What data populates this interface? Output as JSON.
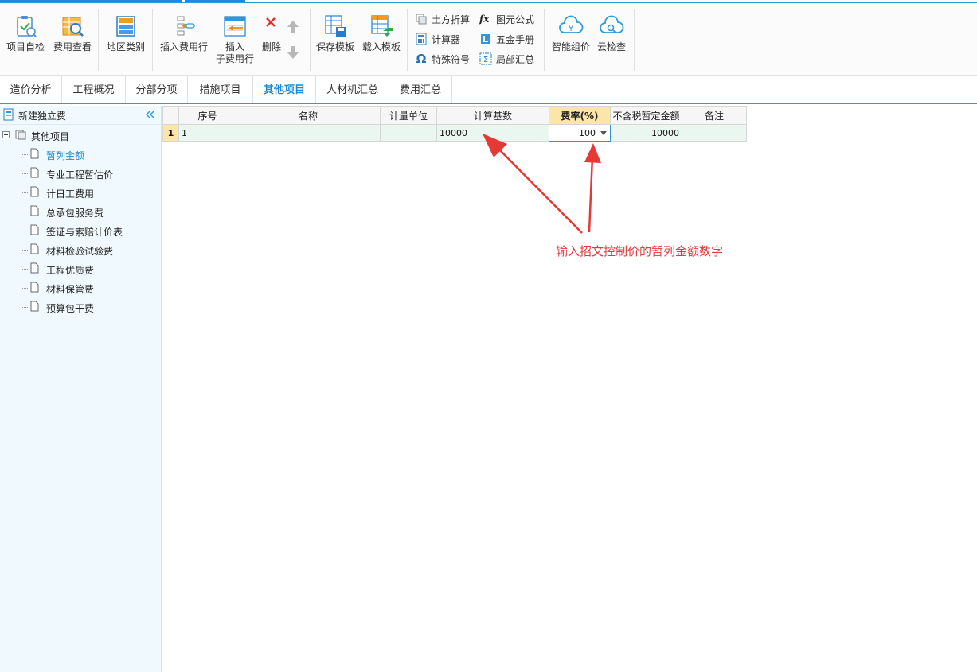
{
  "toolbar": {
    "buttons": {
      "self_check": "项目自检",
      "fee_view": "费用查看",
      "region_type": "地区类别",
      "insert_fee_row": "插入费用行",
      "insert_sub_fee_row_line1": "插入",
      "insert_sub_fee_row_line2": "子费用行",
      "delete": "删除",
      "save_template": "保存模板",
      "load_template": "载入模板",
      "earthwork": "土方折算",
      "calculator": "计算器",
      "special_symbol": "特殊符号",
      "graphic_formula": "图元公式",
      "hardware_manual": "五金手册",
      "local_summary": "局部汇总",
      "smart_pricing": "智能组价",
      "cloud_check": "云检查"
    }
  },
  "tabs": [
    {
      "label": "造价分析"
    },
    {
      "label": "工程概况"
    },
    {
      "label": "分部分项"
    },
    {
      "label": "措施项目"
    },
    {
      "label": "其他项目",
      "active": true
    },
    {
      "label": "人材机汇总"
    },
    {
      "label": "费用汇总"
    }
  ],
  "sidebar": {
    "new_fee": "新建独立费",
    "root": "其他项目",
    "items": [
      {
        "label": "暂列金额",
        "selected": true
      },
      {
        "label": "专业工程暂估价"
      },
      {
        "label": "计日工费用"
      },
      {
        "label": "总承包服务费"
      },
      {
        "label": "签证与索赔计价表"
      },
      {
        "label": "材料检验试验费"
      },
      {
        "label": "工程优质费"
      },
      {
        "label": "材料保管费"
      },
      {
        "label": "预算包干费"
      }
    ]
  },
  "grid": {
    "headers": {
      "seq": "序号",
      "name": "名称",
      "unit": "计量单位",
      "base": "计算基数",
      "rate": "费率(%)",
      "amount": "不含税暂定金额",
      "remark": "备注"
    },
    "rows": [
      {
        "rownum": "1",
        "seq": "1",
        "name": "",
        "unit": "",
        "base": "10000",
        "rate": "100",
        "amount": "10000",
        "remark": ""
      }
    ]
  },
  "annotation": {
    "text": "输入招文控制价的暂列金额数字",
    "color": "#e03b3b"
  },
  "colors": {
    "accent": "#2a9bd8",
    "sidebar_bg": "#f0f9fd",
    "row_bg": "#eaf7f0",
    "header_highlight": "#fbe6a8"
  }
}
